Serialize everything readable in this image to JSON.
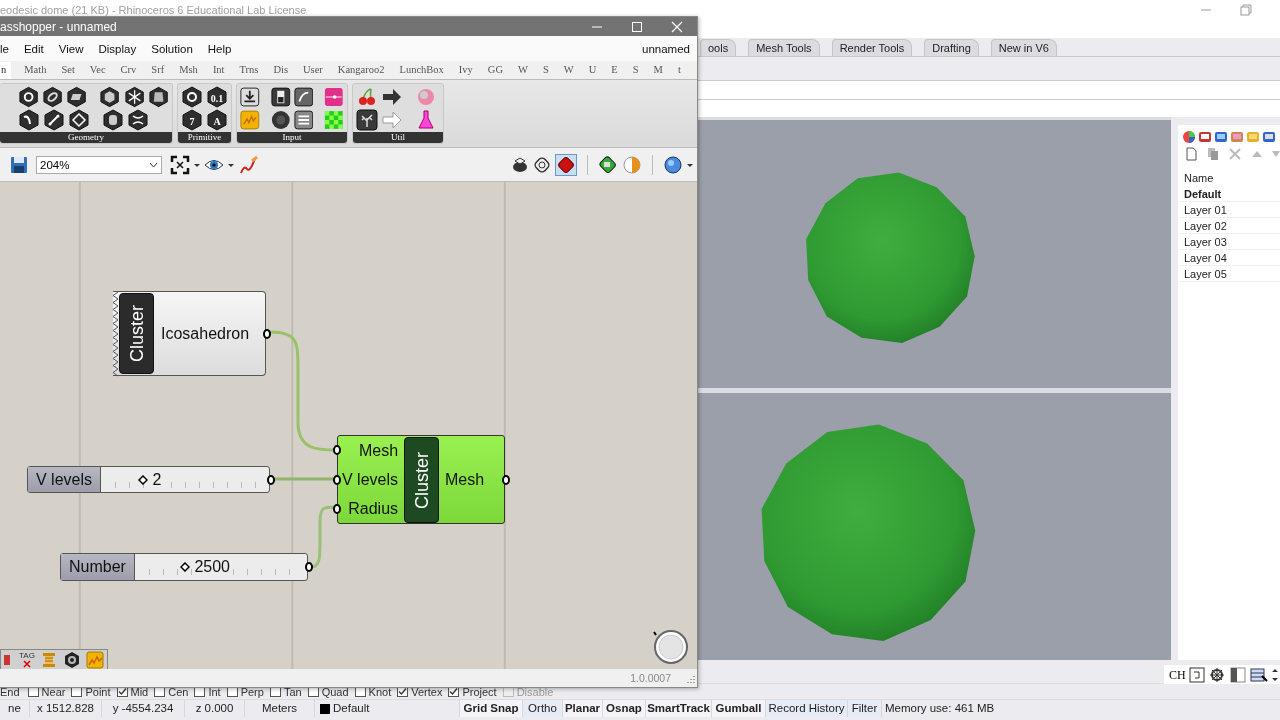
{
  "rhino": {
    "title": "eodesic dome (21 KB) - Rhinoceros 6 Educational Lab License",
    "tabs": [
      {
        "label": "ools",
        "selected": false
      },
      {
        "label": "Mesh Tools",
        "selected": false
      },
      {
        "label": "Render Tools",
        "selected": false
      },
      {
        "label": "Drafting",
        "selected": false
      },
      {
        "label": "New in V6",
        "selected": false
      }
    ],
    "layers": {
      "header": "Name",
      "items": [
        {
          "name": "Default",
          "current": true
        },
        {
          "name": "Layer 01",
          "current": false
        },
        {
          "name": "Layer 02",
          "current": false
        },
        {
          "name": "Layer 03",
          "current": false
        },
        {
          "name": "Layer 04",
          "current": false
        },
        {
          "name": "Layer 05",
          "current": false
        }
      ]
    },
    "viewport_toolbar": {
      "label": "CH"
    },
    "osnaps": [
      {
        "label": "End",
        "kind": "label"
      },
      {
        "label": "Near",
        "kind": "checkbox",
        "checked": false,
        "disabled": false
      },
      {
        "label": "Point",
        "kind": "checkbox",
        "checked": false,
        "disabled": false
      },
      {
        "label": "Mid",
        "kind": "checkbox",
        "checked": true,
        "disabled": false
      },
      {
        "label": "Cen",
        "kind": "checkbox",
        "checked": false,
        "disabled": false
      },
      {
        "label": "Int",
        "kind": "checkbox",
        "checked": false,
        "disabled": false
      },
      {
        "label": "Perp",
        "kind": "checkbox",
        "checked": false,
        "disabled": false
      },
      {
        "label": "Tan",
        "kind": "checkbox",
        "checked": false,
        "disabled": false
      },
      {
        "label": "Quad",
        "kind": "checkbox",
        "checked": false,
        "disabled": false
      },
      {
        "label": "Knot",
        "kind": "checkbox",
        "checked": false,
        "disabled": false
      },
      {
        "label": "Vertex",
        "kind": "checkbox",
        "checked": true,
        "disabled": false
      },
      {
        "label": "Project",
        "kind": "checkbox",
        "checked": true,
        "disabled": false
      },
      {
        "label": "Disable",
        "kind": "checkbox",
        "checked": false,
        "disabled": true
      }
    ],
    "status_bar": [
      {
        "kind": "text",
        "text": "ne"
      },
      {
        "kind": "text",
        "text": "x 1512.828"
      },
      {
        "kind": "text",
        "text": "y -4554.234"
      },
      {
        "kind": "text",
        "text": "z 0.000"
      },
      {
        "kind": "text",
        "text": "Meters"
      },
      {
        "kind": "layer",
        "text": "Default",
        "color": "#000000"
      },
      {
        "kind": "toggle",
        "text": "Grid Snap",
        "on": true
      },
      {
        "kind": "toggle",
        "text": "Ortho",
        "on": false
      },
      {
        "kind": "toggle",
        "text": "Planar",
        "on": true
      },
      {
        "kind": "toggle",
        "text": "Osnap",
        "on": true
      },
      {
        "kind": "toggle",
        "text": "SmartTrack",
        "on": true
      },
      {
        "kind": "toggle",
        "text": "Gumball",
        "on": true
      },
      {
        "kind": "toggle",
        "text": "Record History",
        "on": false
      },
      {
        "kind": "toggle",
        "text": "Filter",
        "on": false
      },
      {
        "kind": "text",
        "text": "Memory use: 461 MB"
      }
    ]
  },
  "grasshopper": {
    "title": "asshopper - unnamed",
    "menu": [
      "le",
      "Edit",
      "View",
      "Display",
      "Solution",
      "Help"
    ],
    "document": "unnamed",
    "tabs": [
      {
        "label": "n",
        "selected": true
      },
      {
        "label": "Math",
        "selected": false
      },
      {
        "label": "Set",
        "selected": false
      },
      {
        "label": "Vec",
        "selected": false
      },
      {
        "label": "Crv",
        "selected": false
      },
      {
        "label": "Srf",
        "selected": false
      },
      {
        "label": "Msh",
        "selected": false
      },
      {
        "label": "Int",
        "selected": false
      },
      {
        "label": "Trns",
        "selected": false
      },
      {
        "label": "Dis",
        "selected": false
      },
      {
        "label": "User",
        "selected": false
      },
      {
        "label": "Kangaroo2",
        "selected": false
      },
      {
        "label": "LunchBox",
        "selected": false
      },
      {
        "label": "Ivy",
        "selected": false
      },
      {
        "label": "GG",
        "selected": false
      },
      {
        "label": "W",
        "selected": false
      },
      {
        "label": "S",
        "selected": false
      },
      {
        "label": "W",
        "selected": false
      },
      {
        "label": "U",
        "selected": false
      },
      {
        "label": "E",
        "selected": false
      },
      {
        "label": "S",
        "selected": false
      },
      {
        "label": "M",
        "selected": false
      },
      {
        "label": "t",
        "selected": false
      }
    ],
    "ribbon": [
      {
        "label": "Geometry"
      },
      {
        "label": "Primitive",
        "glyphs": [
          "0.1",
          "7",
          "A"
        ]
      },
      {
        "label": "Input"
      },
      {
        "label": "Util"
      }
    ],
    "zoom": "204%",
    "nodes": [
      {
        "kind": "cluster",
        "tab": "Cluster",
        "label": "Icosahedron"
      },
      {
        "kind": "component",
        "tab": "Cluster",
        "inputs": [
          "Mesh",
          "V levels",
          "Radius"
        ],
        "outputs": [
          "Mesh"
        ]
      },
      {
        "kind": "slider",
        "label": "V levels",
        "value": "2",
        "level": 0.2
      },
      {
        "kind": "slider",
        "label": "Number",
        "value": "2500",
        "level": 0.25
      }
    ],
    "canvas_toolbar": {
      "tag": "TAG"
    },
    "version": "1.0.0007"
  }
}
